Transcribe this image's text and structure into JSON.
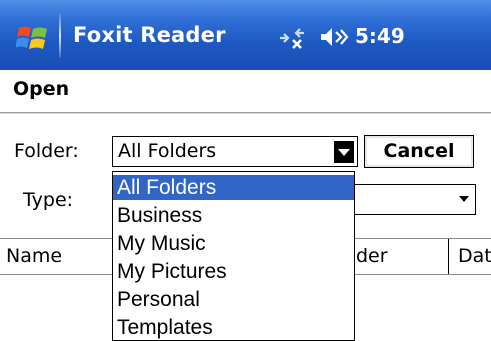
{
  "status_bar": {
    "app_title": "Foxit Reader",
    "time": "5:49",
    "icons": [
      "windows-start-logo",
      "connectivity-icon",
      "volume-muted-icon"
    ]
  },
  "dialog": {
    "title": "Open"
  },
  "form": {
    "folder_label": "Folder:",
    "folder_value": "All Folders",
    "cancel_label": "Cancel",
    "type_label": "Type:",
    "type_value": ""
  },
  "folder_dropdown": {
    "items": [
      "All Folders",
      "Business",
      "My Music",
      "My Pictures",
      "Personal",
      "Templates"
    ],
    "selected_index": 0
  },
  "file_list": {
    "columns": [
      "Name",
      "Folder",
      "Date"
    ],
    "visible_column_text": [
      "Name",
      "der",
      "Dat"
    ]
  },
  "colors": {
    "title_bar": "#1d58c2",
    "selection": "#3166c8"
  }
}
